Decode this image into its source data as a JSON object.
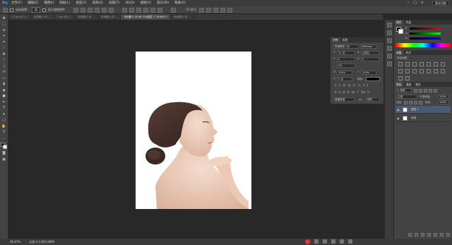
{
  "app": {
    "logo": "Ps",
    "workspace": "基本功能"
  },
  "menu": [
    "文件(F)",
    "编辑(E)",
    "图像(I)",
    "图层(L)",
    "类型(Y)",
    "选择(S)",
    "滤镜(T)",
    "3D(D)",
    "视图(V)",
    "窗口(W)",
    "帮助(H)"
  ],
  "options_bar": {
    "auto_select_label": "自动选择：",
    "auto_select_value": "组",
    "show_transform": "显示变换控件"
  },
  "tabs": [
    {
      "label": "11.jpg @ 9...",
      "active": false
    },
    {
      "label": "未标题-1 @ ...",
      "active": false
    },
    {
      "label": "1.jpg @ 6...",
      "active": false
    },
    {
      "label": "未标题-2 @ ...",
      "active": false
    },
    {
      "label": "未标题-3 @ ...",
      "active": false
    },
    {
      "label": "未标题-5 @ 66.7%(图层 1, RGB/8) *",
      "active": true
    },
    {
      "label": "未标题-4 @ ...",
      "active": false
    }
  ],
  "status": {
    "zoom": "66.67%",
    "doc": "文档:3.11M/3.86M"
  },
  "character_panel": {
    "tabs": [
      "字符",
      "段落"
    ],
    "font_family": "思源黑体 CN",
    "font_style": "Medium",
    "font_size": "12 点",
    "leading": "(自动)",
    "kerning": "0",
    "tracking": "0",
    "tracking_pct": "0%",
    "vscale": "100%",
    "hscale": "100%",
    "baseline": "0 点",
    "color_label": "颜色:",
    "language": "美国英语",
    "aa": "aa",
    "aa_mode": "锐利"
  },
  "color_panel": {
    "tabs": [
      "颜色",
      "色板"
    ],
    "channels": [
      "R",
      "G",
      "B"
    ]
  },
  "adjustments_panel": {
    "tabs": [
      "调整",
      "样式"
    ],
    "hint": "添加调整"
  },
  "layers_panel": {
    "tabs": [
      "图层",
      "通道",
      "路径"
    ],
    "kind": "ρ 类型",
    "blend_mode": "正常",
    "opacity_label": "不透明度:",
    "opacity": "100%",
    "lock_label": "锁定:",
    "fill_label": "填充:",
    "fill": "100%",
    "layers": [
      {
        "name": "图层 1",
        "selected": true
      },
      {
        "name": "背景",
        "selected": false
      }
    ]
  }
}
